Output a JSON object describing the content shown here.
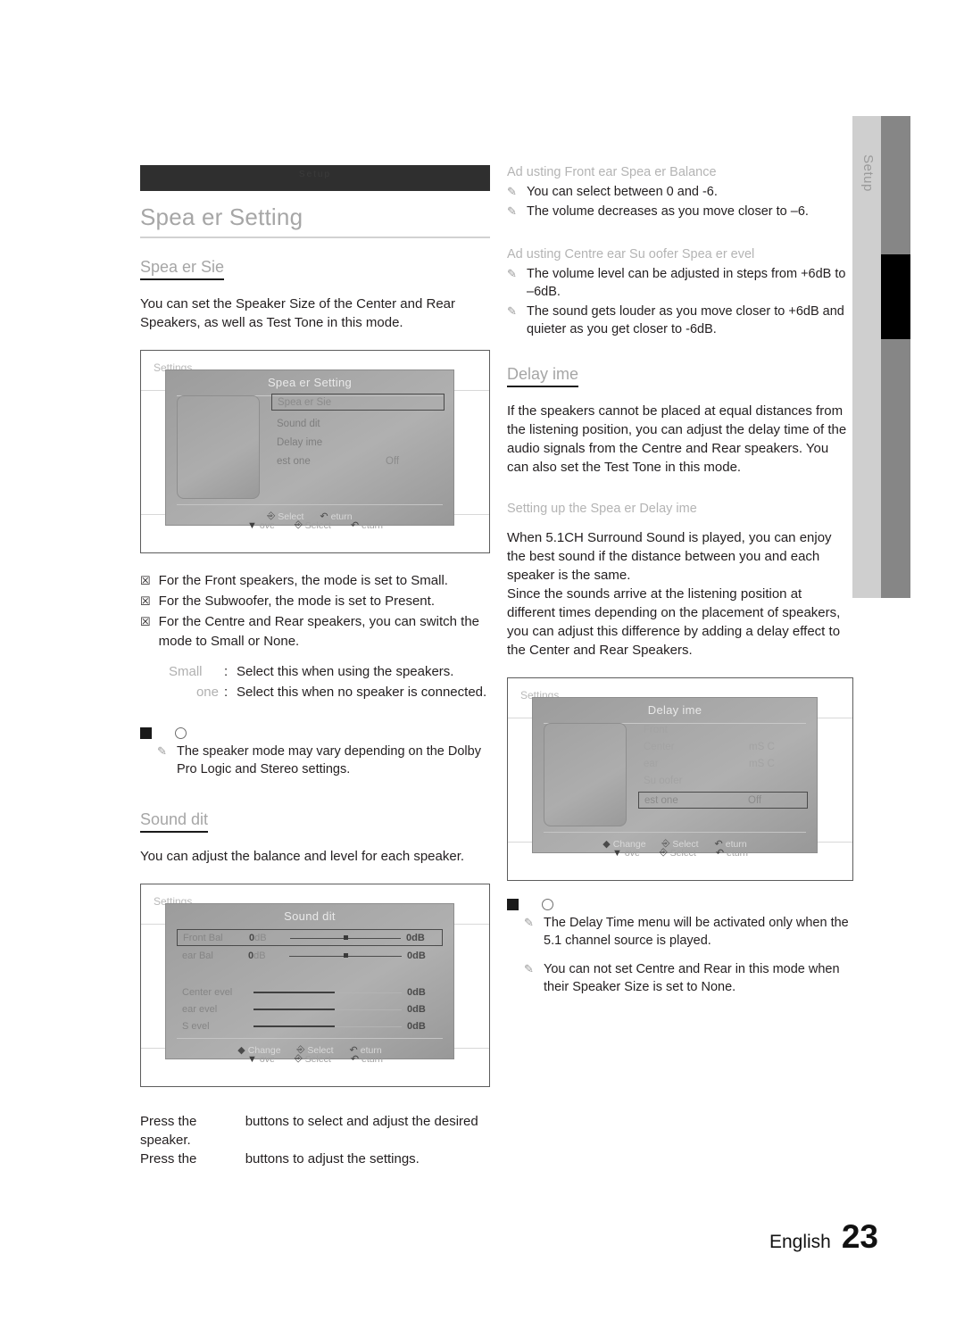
{
  "side_tab": {
    "label": "Setup"
  },
  "left": {
    "dark_bar_text": "Setup",
    "page_title": "Spea er Setting",
    "speaker_size": {
      "heading": "Spea er Sie",
      "body": "You can set the Speaker Size of the Center and Rear Speakers, as well as Test Tone in this mode."
    },
    "shot1": {
      "bg_label": "Settings",
      "title": "Spea er Setting",
      "rows": [
        {
          "label": "Spea er Sie",
          "value": "",
          "selected": true
        },
        {
          "label": "Sound dit",
          "value": "",
          "selected": false
        },
        {
          "label": "Delay ime",
          "value": "",
          "selected": false
        },
        {
          "label": "est one",
          "value": "Off",
          "selected": false
        }
      ],
      "footer": [
        {
          "icon": "enter-icon",
          "label": "Select"
        },
        {
          "icon": "return-icon",
          "label": "eturn"
        }
      ],
      "ghost_footer": [
        {
          "icon": "down-arrow-icon",
          "label": "ove"
        },
        {
          "icon": "enter-icon",
          "label": "Select"
        },
        {
          "icon": "return-icon",
          "label": "eturn"
        }
      ]
    },
    "bullets": [
      "For the Front speakers, the mode is set to Small.",
      "For the Subwoofer, the mode is set to Present.",
      "For the Centre and Rear speakers, you can switch the mode to Small or None."
    ],
    "definitions": [
      {
        "term": "Small",
        "desc": "Select this when using the speakers."
      },
      {
        "term": "one",
        "desc": "Select this when no speaker is connected."
      }
    ],
    "note1": [
      "The speaker mode may vary depending on the Dolby Pro Logic and Stereo settings."
    ],
    "sound_edit": {
      "heading": "Sound dit",
      "body": "You can adjust the balance and level for each speaker."
    },
    "shot2": {
      "bg_label": "Settings",
      "title": "Sound dit",
      "balance_rows": [
        {
          "name": "Front Bal",
          "left_db": "0",
          "right_db": "0",
          "unit": "dB",
          "selected": true
        },
        {
          "name": "ear Bal",
          "left_db": "0",
          "right_db": "0",
          "unit": "dB",
          "selected": false
        }
      ],
      "level_rows": [
        {
          "name": "Center evel",
          "db": "0",
          "unit": "dB"
        },
        {
          "name": "ear evel",
          "db": "0",
          "unit": "dB"
        },
        {
          "name": "S evel",
          "db": "0",
          "unit": "dB"
        }
      ],
      "footer": [
        {
          "icon": "left-right-icon",
          "label": "Change"
        },
        {
          "icon": "enter-icon",
          "label": "Select"
        },
        {
          "icon": "return-icon",
          "label": "eturn"
        }
      ],
      "ghost_footer": [
        {
          "icon": "down-arrow-icon",
          "label": "ove"
        },
        {
          "icon": "enter-icon",
          "label": "Select"
        },
        {
          "icon": "return-icon",
          "label": "eturn"
        }
      ]
    },
    "press_lines": [
      {
        "pre": "Press the",
        "post": "buttons to select and adjust the desired speaker."
      },
      {
        "pre": "Press the",
        "post": "buttons to adjust the settings."
      }
    ]
  },
  "right": {
    "balance_section": {
      "heading": "Ad usting Front  ear Spea er Balance",
      "notes": [
        "You can select between 0 and -6.",
        "The volume decreases as you move closer to –6."
      ]
    },
    "level_section": {
      "heading": "Ad usting Centre  ear Su  oofer Spea er  evel",
      "notes": [
        "The volume level can be adjusted in steps from +6dB to –6dB.",
        "The sound gets louder as you move closer to +6dB and quieter as you get closer to -6dB."
      ]
    },
    "delay_time": {
      "heading": "Delay ime",
      "body": "If the speakers cannot be placed at equal distances from the listening position, you can adjust the delay time of the audio signals from the Centre and  Rear speakers. You can also set the Test Tone in this mode."
    },
    "setting_up": {
      "heading": "Setting up the Spea er Delay ime",
      "body1": "When 5.1CH Surround Sound is played, you can enjoy the best sound if the distance between you and each speaker is the same.",
      "body2": "Since the sounds arrive at the listening position at different times depending on the placement of speakers, you can adjust this difference by adding a delay effect to the Center and Rear Speakers."
    },
    "shot3": {
      "bg_label": "Settings",
      "title": "Delay ime",
      "rows": [
        {
          "label": "Front",
          "value": "",
          "selected": false,
          "faint": true
        },
        {
          "label": "Center",
          "value": "mS C",
          "selected": false,
          "faint": true
        },
        {
          "label": "ear",
          "value": "mS C",
          "selected": false,
          "faint": true
        },
        {
          "label": "Su oofer",
          "value": "",
          "selected": false,
          "faint": true
        },
        {
          "label": "est one",
          "value": "Off",
          "selected": true,
          "faint": false
        }
      ],
      "footer": [
        {
          "icon": "left-right-icon",
          "label": "Change"
        },
        {
          "icon": "enter-icon",
          "label": "Select"
        },
        {
          "icon": "return-icon",
          "label": "eturn"
        }
      ],
      "ghost_footer": [
        {
          "icon": "down-arrow-icon",
          "label": "ove"
        },
        {
          "icon": "enter-icon",
          "label": "Select"
        },
        {
          "icon": "return-icon",
          "label": "eturn"
        }
      ]
    },
    "note2": [
      "The Delay Time menu will be activated only when the 5.1 channel source is played.",
      "You can not set Centre and Rear in this mode when their Speaker Size is set to None."
    ]
  },
  "footer": {
    "language": "English",
    "page_number": "23"
  }
}
